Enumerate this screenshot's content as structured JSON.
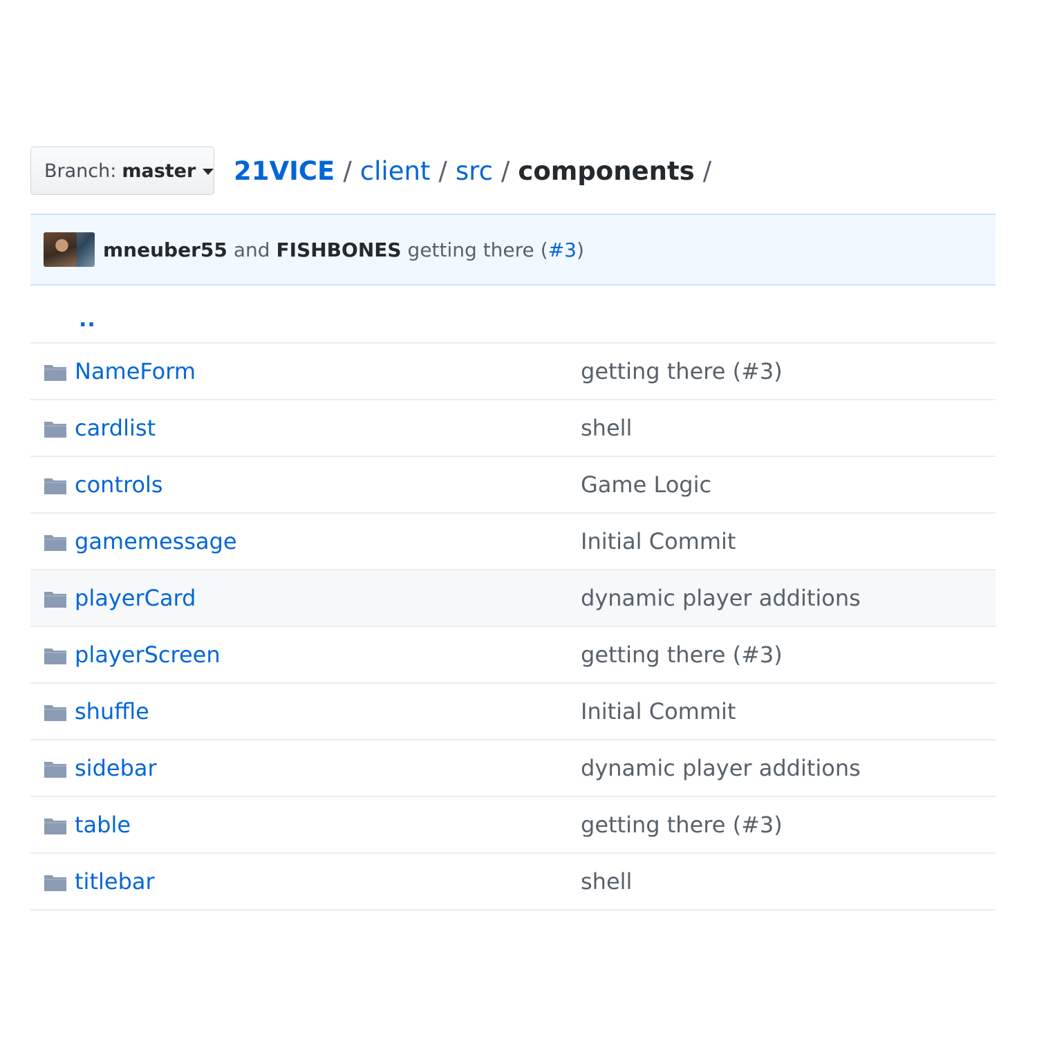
{
  "branch": {
    "prefix": "Branch:",
    "name": "master"
  },
  "breadcrumb": {
    "repo": "21VICE",
    "path": [
      "client",
      "src"
    ],
    "current": "components",
    "separator": "/"
  },
  "commit": {
    "author1": "mneuber55",
    "conjunction": "and",
    "author2": "FISHBONES",
    "message": "getting there",
    "paren_open": "(",
    "issue": "#3",
    "paren_close": ")"
  },
  "up_link": "..",
  "files": [
    {
      "name": "NameForm",
      "message": "getting there (#3)"
    },
    {
      "name": "cardlist",
      "message": "shell"
    },
    {
      "name": "controls",
      "message": "Game Logic"
    },
    {
      "name": "gamemessage",
      "message": "Initial Commit"
    },
    {
      "name": "playerCard",
      "message": "dynamic player additions"
    },
    {
      "name": "playerScreen",
      "message": "getting there (#3)"
    },
    {
      "name": "shuffle",
      "message": "Initial Commit"
    },
    {
      "name": "sidebar",
      "message": "dynamic player additions"
    },
    {
      "name": "table",
      "message": "getting there (#3)"
    },
    {
      "name": "titlebar",
      "message": "shell"
    }
  ],
  "colors": {
    "link": "#0366d6",
    "folder": "#79b8ff",
    "folder_fill": "#8a9bb3",
    "commit_bg": "#f1f8ff",
    "hover_row": "#f6f8fa"
  }
}
